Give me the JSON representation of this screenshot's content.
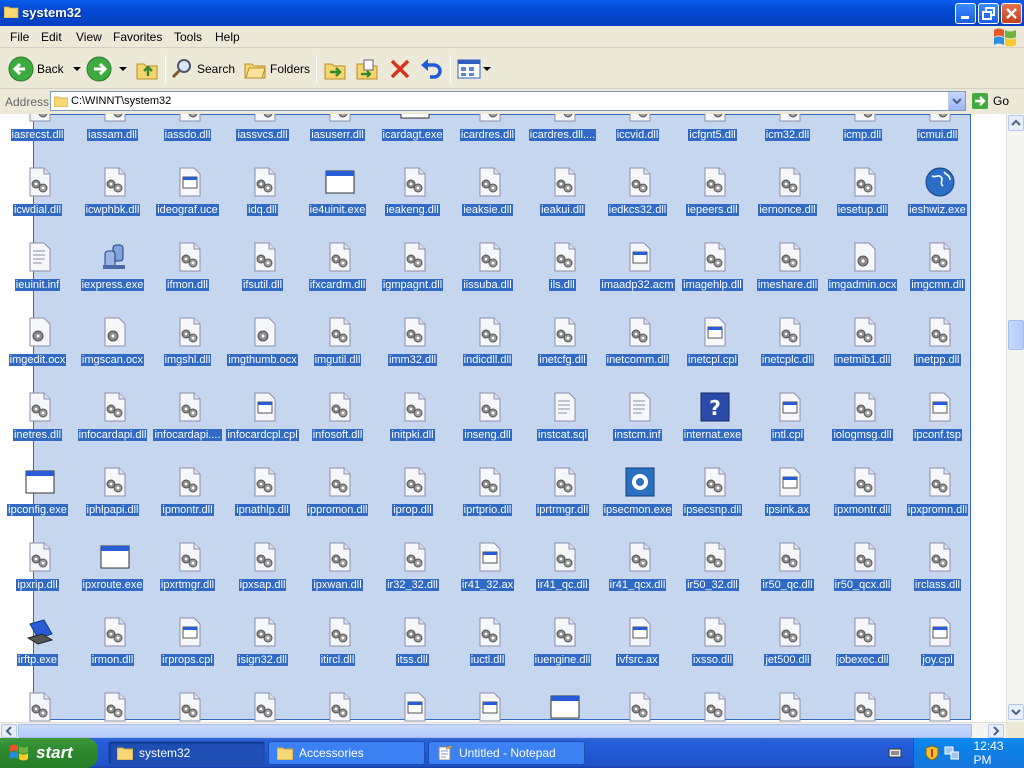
{
  "window": {
    "title": "system32"
  },
  "menu": [
    "File",
    "Edit",
    "View",
    "Favorites",
    "Tools",
    "Help"
  ],
  "toolbar": {
    "back": "Back",
    "search": "Search",
    "folders": "Folders"
  },
  "address": {
    "label": "Address",
    "value": "C:\\WINNT\\system32",
    "go": "Go"
  },
  "files": [
    [
      "iasrecst.dll",
      "iassam.dll",
      "iassdo.dll",
      "iassvcs.dll",
      "iasuserr.dll",
      "icardagt.exe",
      "icardres.dll",
      "icardres.dll....",
      "iccvid.dll",
      "icfgnt5.dll",
      "icm32.dll",
      "icmp.dll",
      "icmui.dll"
    ],
    [
      "icwdial.dll",
      "icwphbk.dll",
      "ideograf.uce",
      "idq.dll",
      "ie4uinit.exe",
      "ieakeng.dll",
      "ieaksie.dll",
      "ieakui.dll",
      "iedkcs32.dll",
      "iepeers.dll",
      "iernonce.dll",
      "iesetup.dll",
      "ieshwiz.exe"
    ],
    [
      "ieuinit.inf",
      "iexpress.exe",
      "ifmon.dll",
      "ifsutil.dll",
      "ifxcardm.dll",
      "igmpagnt.dll",
      "iissuba.dll",
      "ils.dll",
      "imaadp32.acm",
      "imagehlp.dll",
      "imeshare.dll",
      "imgadmin.ocx",
      "imgcmn.dll"
    ],
    [
      "imgedit.ocx",
      "imgscan.ocx",
      "imgshl.dll",
      "imgthumb.ocx",
      "imgutil.dll",
      "imm32.dll",
      "indicdll.dll",
      "inetcfg.dll",
      "inetcomm.dll",
      "inetcpl.cpl",
      "inetcplc.dll",
      "inetmib1.dll",
      "inetpp.dll"
    ],
    [
      "inetres.dll",
      "infocardapi.dll",
      "infocardapi....",
      "infocardcpl.cpl",
      "infosoft.dll",
      "initpki.dll",
      "inseng.dll",
      "instcat.sql",
      "instcm.inf",
      "internat.exe",
      "intl.cpl",
      "iologmsg.dll",
      "ipconf.tsp"
    ],
    [
      "ipconfig.exe",
      "iphlpapi.dll",
      "ipmontr.dll",
      "ipnathlp.dll",
      "ippromon.dll",
      "iprop.dll",
      "iprtprio.dll",
      "iprtrmgr.dll",
      "ipsecmon.exe",
      "ipsecsnp.dll",
      "ipsink.ax",
      "ipxmontr.dll",
      "ipxpromn.dll"
    ],
    [
      "ipxrip.dll",
      "ipxroute.exe",
      "ipxrtmgr.dll",
      "ipxsap.dll",
      "ipxwan.dll",
      "ir32_32.dll",
      "ir41_32.ax",
      "ir41_qc.dll",
      "ir41_qcx.dll",
      "ir50_32.dll",
      "ir50_qc.dll",
      "ir50_qcx.dll",
      "irclass.dll"
    ],
    [
      "irftp.exe",
      "irmon.dll",
      "irprops.cpl",
      "isign32.dll",
      "itircl.dll",
      "itss.dll",
      "iuctl.dll",
      "iuengine.dll",
      "ivfsrc.ax",
      "ixsso.dll",
      "jet500.dll",
      "jobexec.dll",
      "joy.cpl"
    ]
  ],
  "taskbar": {
    "start": "start",
    "tasks": [
      "system32",
      "Accessories",
      "Untitled - Notepad"
    ],
    "clock": "12:43 PM"
  }
}
